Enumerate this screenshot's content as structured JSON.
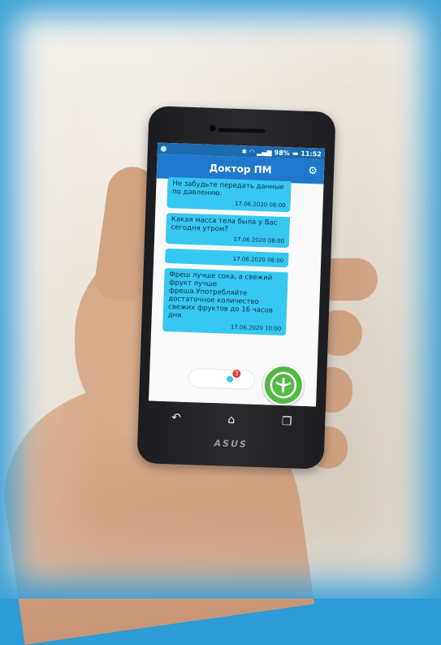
{
  "status_bar": {
    "battery": "98%",
    "time": "11:52"
  },
  "app": {
    "title": "Доктор ПМ",
    "settings_icon": "gear-icon"
  },
  "messages": [
    {
      "text": "Не забудьте передать данные по давлению.",
      "time": "17.06.2020 08:00"
    },
    {
      "text": "Какая масса тела была у Вас сегодня утром?",
      "time": "17.06.2020 08:00"
    },
    {
      "text": "",
      "time": "17.06.2020 08:00"
    },
    {
      "text": "Фреш лучше сока, а свежий фрукт лучше фреша.Употребляйте достаточное количество свежих фруктов до 16 часов дня.",
      "time": "17.06.2020 10:00"
    }
  ],
  "bottom": {
    "badge_count": "3"
  },
  "device": {
    "brand": "ASUS"
  },
  "colors": {
    "appbar": "#2078cc",
    "bubble": "#37c8f1",
    "logo": "#54b947",
    "frame": "#2d9bd6"
  }
}
